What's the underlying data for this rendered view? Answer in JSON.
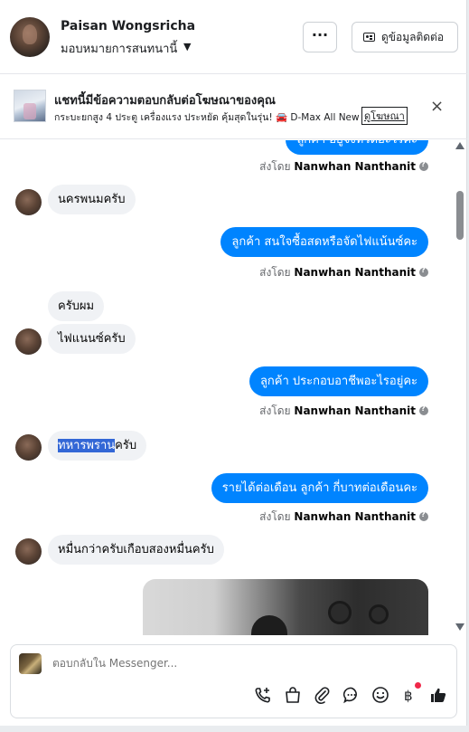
{
  "header": {
    "name": "Paisan Wongsricha",
    "subtitle": "มอบหมายการสนทนานี้",
    "more_label": "···",
    "contact_label": "ดูข้อมูลติดต่อ"
  },
  "ad": {
    "title": "แชทนี้มีข้อความตอบกลับต่อโฆษณาของคุณ",
    "description": "กระบะยกสูง 4 ประตู เครื่องแรง ประหยัด คุ้มสุดในรุ่น! 🚘 D-Max All New C...",
    "link_label": "ดูโฆษณา",
    "close_label": "×"
  },
  "messages": {
    "out_0_partial": "ลูกค้า อยู่จังหวัดอะไรคะ",
    "sent_by_prefix": "ส่งโดย",
    "sender": "Nanwhan Nanthanit",
    "in_1": "นครพนมครับ",
    "out_2": "ลูกค้า สนใจซื้อสดหรือจัดไฟแน้นซ์คะ",
    "in_3": "ครับผม",
    "in_4": "ไฟแนนซ์ครับ",
    "out_5": "ลูกค้า ประกอบอาชีพอะไรอยู่คะ",
    "in_6_highlight": "ทหารพราน",
    "in_6_rest": "ครับ",
    "out_7": "รายได้ต่อเดือน ลูกค้า กี่บาทต่อเดือนคะ",
    "in_8": "หมื่นกว่าครับเกือบสองหมื่นครับ"
  },
  "composer": {
    "placeholder": "ตอบกลับใน Messenger..."
  },
  "icons": [
    "caret-down-icon",
    "card-icon",
    "close-icon",
    "info-icon",
    "call-add-icon",
    "shopping-bag-icon",
    "paperclip-icon",
    "chat-bubble-icon",
    "emoji-icon",
    "baht-icon",
    "thumbs-up-icon"
  ],
  "colors": {
    "outgoing_bubble": "#0084ff",
    "incoming_bubble": "#f0f2f5",
    "highlight": "#3367d6",
    "notification_dot": "#f02849"
  }
}
